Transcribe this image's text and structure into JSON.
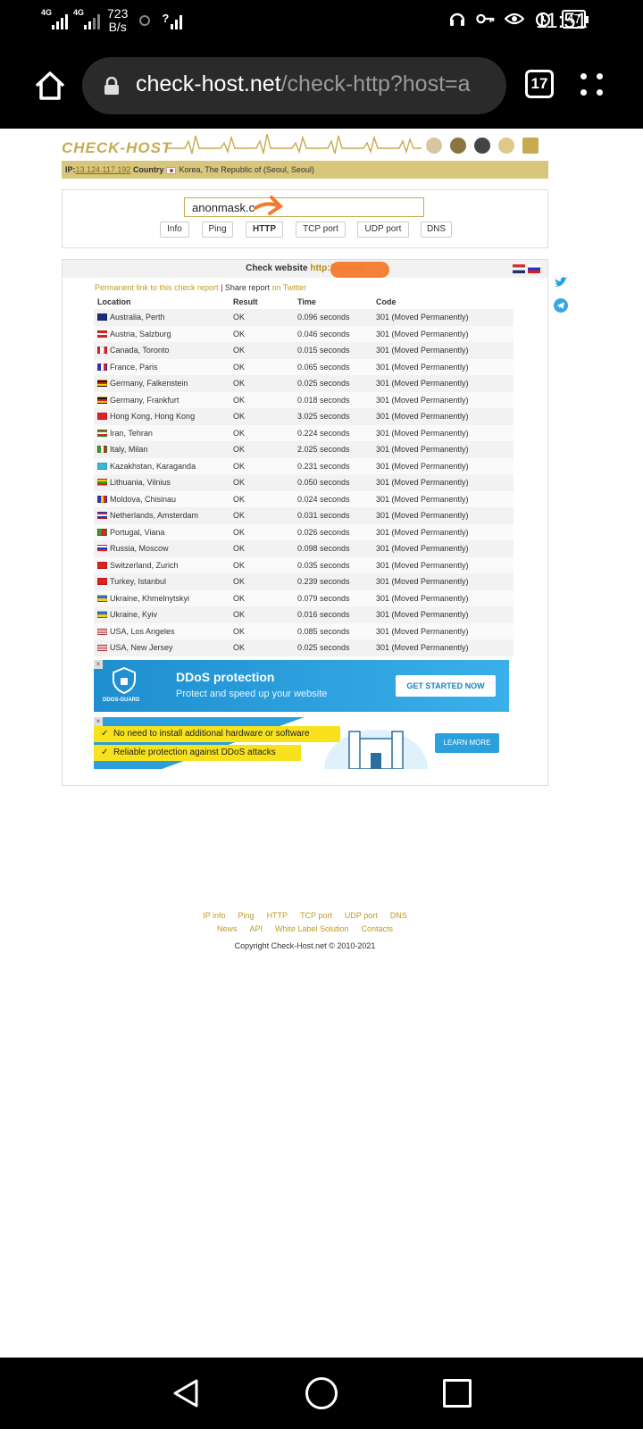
{
  "status_bar": {
    "signal1_tag": "4G",
    "signal2_tag": "4G",
    "speed": "723",
    "speed_unit": "B/s",
    "wifi_label": "?",
    "battery": "47",
    "time": "11:51"
  },
  "browser": {
    "url_host": "check-host.net",
    "url_path": "/check-http?host=a",
    "tab_count": "17"
  },
  "site": {
    "logo": "CHECK-HOST",
    "ip_label": "IP:",
    "ip_value": "13.124.117.192",
    "country_label": "Country",
    "country_value": "Korea, The Republic of (Seoul, Seoul)",
    "host_input_value": "anonmask.c",
    "tabs": [
      "Info",
      "Ping",
      "HTTP",
      "TCP port",
      "UDP port",
      "DNS"
    ],
    "active_tab": "HTTP",
    "check_title": "Check website",
    "check_url": "http://anonm",
    "permalink": "Permanent link to this check report",
    "share_sep": " | Share report ",
    "share_twitter": "on Twitter",
    "columns": [
      "Location",
      "Result",
      "Time",
      "Code"
    ],
    "rows": [
      {
        "flag": "au",
        "location": "Australia, Perth",
        "result": "OK",
        "time": "0.096 seconds",
        "code": "301 (Moved Permanently)"
      },
      {
        "flag": "at",
        "location": "Austria, Salzburg",
        "result": "OK",
        "time": "0.046 seconds",
        "code": "301 (Moved Permanently)"
      },
      {
        "flag": "ca",
        "location": "Canada, Toronto",
        "result": "OK",
        "time": "0.015 seconds",
        "code": "301 (Moved Permanently)"
      },
      {
        "flag": "fr",
        "location": "France, Paris",
        "result": "OK",
        "time": "0.065 seconds",
        "code": "301 (Moved Permanently)"
      },
      {
        "flag": "de",
        "location": "Germany, Falkenstein",
        "result": "OK",
        "time": "0.025 seconds",
        "code": "301 (Moved Permanently)"
      },
      {
        "flag": "de",
        "location": "Germany, Frankfurt",
        "result": "OK",
        "time": "0.018 seconds",
        "code": "301 (Moved Permanently)"
      },
      {
        "flag": "hk",
        "location": "Hong Kong, Hong Kong",
        "result": "OK",
        "time": "3.025 seconds",
        "code": "301 (Moved Permanently)"
      },
      {
        "flag": "ir",
        "location": "Iran, Tehran",
        "result": "OK",
        "time": "0.224 seconds",
        "code": "301 (Moved Permanently)"
      },
      {
        "flag": "it",
        "location": "Italy, Milan",
        "result": "OK",
        "time": "2.025 seconds",
        "code": "301 (Moved Permanently)"
      },
      {
        "flag": "kz",
        "location": "Kazakhstan, Karaganda",
        "result": "OK",
        "time": "0.231 seconds",
        "code": "301 (Moved Permanently)"
      },
      {
        "flag": "lt",
        "location": "Lithuania, Vilnius",
        "result": "OK",
        "time": "0.050 seconds",
        "code": "301 (Moved Permanently)"
      },
      {
        "flag": "md",
        "location": "Moldova, Chisinau",
        "result": "OK",
        "time": "0.024 seconds",
        "code": "301 (Moved Permanently)"
      },
      {
        "flag": "nl",
        "location": "Netherlands, Amsterdam",
        "result": "OK",
        "time": "0.031 seconds",
        "code": "301 (Moved Permanently)"
      },
      {
        "flag": "pt",
        "location": "Portugal, Viana",
        "result": "OK",
        "time": "0.026 seconds",
        "code": "301 (Moved Permanently)"
      },
      {
        "flag": "ru",
        "location": "Russia, Moscow",
        "result": "OK",
        "time": "0.098 seconds",
        "code": "301 (Moved Permanently)"
      },
      {
        "flag": "ch",
        "location": "Switzerland, Zurich",
        "result": "OK",
        "time": "0.035 seconds",
        "code": "301 (Moved Permanently)"
      },
      {
        "flag": "tr",
        "location": "Turkey, Istanbul",
        "result": "OK",
        "time": "0.239 seconds",
        "code": "301 (Moved Permanently)"
      },
      {
        "flag": "ua",
        "location": "Ukraine, Khmelnytskyi",
        "result": "OK",
        "time": "0.079 seconds",
        "code": "301 (Moved Permanently)"
      },
      {
        "flag": "ua",
        "location": "Ukraine, Kyiv",
        "result": "OK",
        "time": "0.016 seconds",
        "code": "301 (Moved Permanently)"
      },
      {
        "flag": "us",
        "location": "USA, Los Angeles",
        "result": "OK",
        "time": "0.085 seconds",
        "code": "301 (Moved Permanently)"
      },
      {
        "flag": "us",
        "location": "USA, New Jersey",
        "result": "OK",
        "time": "0.025 seconds",
        "code": "301 (Moved Permanently)"
      }
    ],
    "ad1": {
      "brand": "DDOS-GUARD",
      "title": "DDoS protection",
      "subtitle": "Protect and speed up your website",
      "cta": "GET STARTED NOW"
    },
    "ad2": {
      "line1": "No need to install additional hardware or software",
      "line2": "Reliable protection against DDoS attacks",
      "cta": "LEARN MORE"
    },
    "footer_row1": [
      "IP info",
      "Ping",
      "HTTP",
      "TCP port",
      "UDP port",
      "DNS"
    ],
    "footer_row2": [
      "News",
      "API",
      "White Label Solution",
      "Contacts"
    ],
    "copyright": "Copyright Check-Host.net © 2010-2021"
  },
  "colors": {
    "gold": "#c8aa50",
    "ipbar": "#d8c67c",
    "ad_blue": "#2aa1dc",
    "highlight_orange": "#f47a2e"
  }
}
